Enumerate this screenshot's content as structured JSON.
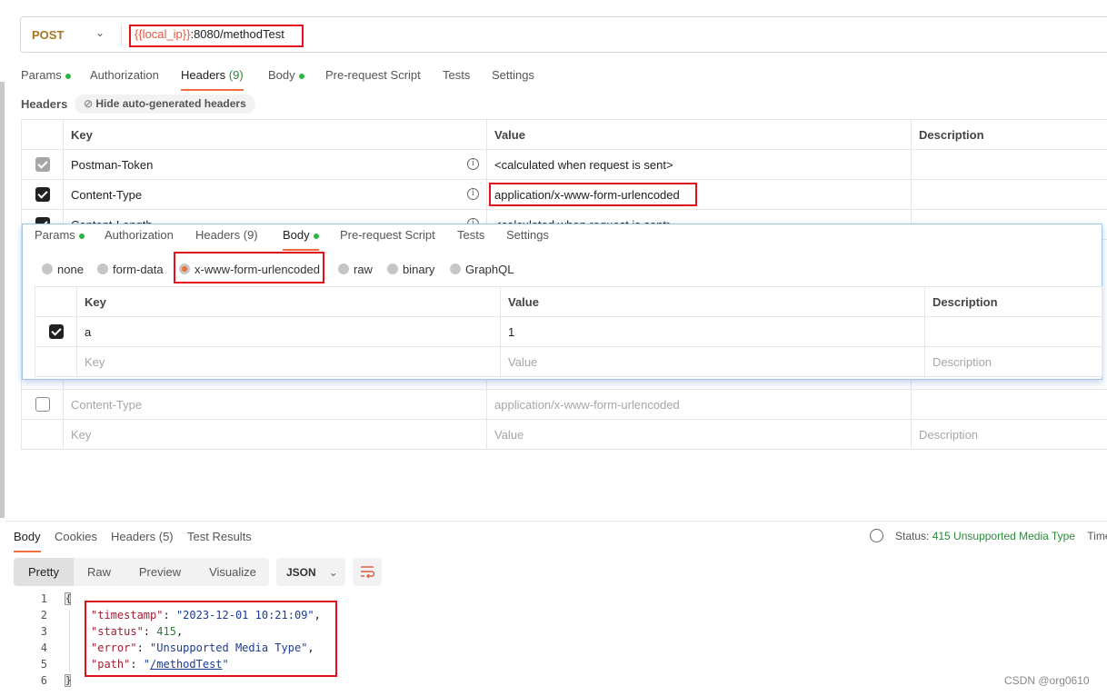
{
  "request": {
    "method": "POST",
    "url_variable": "{{local_ip}}",
    "url_rest": ":8080/methodTest"
  },
  "tabs": [
    {
      "label": "Params",
      "dot": true
    },
    {
      "label": "Authorization"
    },
    {
      "label": "Headers",
      "count": "(9)",
      "active": true
    },
    {
      "label": "Body",
      "dot": true
    },
    {
      "label": "Pre-request Script"
    },
    {
      "label": "Tests"
    },
    {
      "label": "Settings"
    }
  ],
  "headers_section": {
    "label": "Headers",
    "hide_button": "Hide auto-generated headers"
  },
  "headers_table": {
    "columns": [
      "Key",
      "Value",
      "Description"
    ],
    "rows": [
      {
        "key": "Postman-Token",
        "value": "<calculated when request is sent>",
        "state": "disabled"
      },
      {
        "key": "Content-Type",
        "value": "application/x-www-form-urlencoded",
        "state": "checked"
      },
      {
        "key": "Content-Length",
        "value": "<calculated when request is sent>",
        "state": "checked"
      },
      {
        "key": "Content-Type",
        "value": "application/x-www-form-urlencoded",
        "state": "unchecked"
      }
    ],
    "placeholder": {
      "key": "Key",
      "value": "Value",
      "description": "Description"
    }
  },
  "overlay": {
    "tabs": [
      {
        "label": "Params"
      },
      {
        "label": "Authorization"
      },
      {
        "label": "Headers (9)"
      },
      {
        "label": "Body",
        "active": true
      },
      {
        "label": "Pre-request Script"
      },
      {
        "label": "Tests"
      },
      {
        "label": "Settings"
      }
    ],
    "body_types": [
      "none",
      "form-data",
      "x-www-form-urlencoded",
      "raw",
      "binary",
      "GraphQL"
    ],
    "selected_body_type": "x-www-form-urlencoded",
    "columns": [
      "Key",
      "Value",
      "Description"
    ],
    "rows": [
      {
        "key": "a",
        "value": "1",
        "checked": true
      }
    ],
    "placeholder": {
      "key": "Key",
      "value": "Value",
      "description": "Description"
    }
  },
  "response": {
    "tabs": [
      "Body",
      "Cookies",
      "Headers (5)",
      "Test Results"
    ],
    "views": [
      "Pretty",
      "Raw",
      "Preview",
      "Visualize"
    ],
    "format": "JSON",
    "status_label": "Status:",
    "status_value": "415 Unsupported Media Type",
    "time_label": "Time",
    "lines": [
      {
        "n": "1",
        "text": "{"
      },
      {
        "n": "2",
        "key": "\"timestamp\"",
        "val": "\"2023-12-01 10:21:09\"",
        "end": ","
      },
      {
        "n": "3",
        "key": "\"status\"",
        "num": "415",
        "end": ","
      },
      {
        "n": "4",
        "key": "\"error\"",
        "val": "\"Unsupported Media Type\"",
        "end": ","
      },
      {
        "n": "5",
        "key": "\"path\"",
        "link": "/methodTest"
      },
      {
        "n": "6",
        "text": "}"
      }
    ]
  },
  "watermark": "CSDN @org0610",
  "colors": {
    "accent": "#f26b3a",
    "highlight": "#e3101e",
    "status_ok": "#2a8a3a",
    "method": "#a5761d"
  }
}
